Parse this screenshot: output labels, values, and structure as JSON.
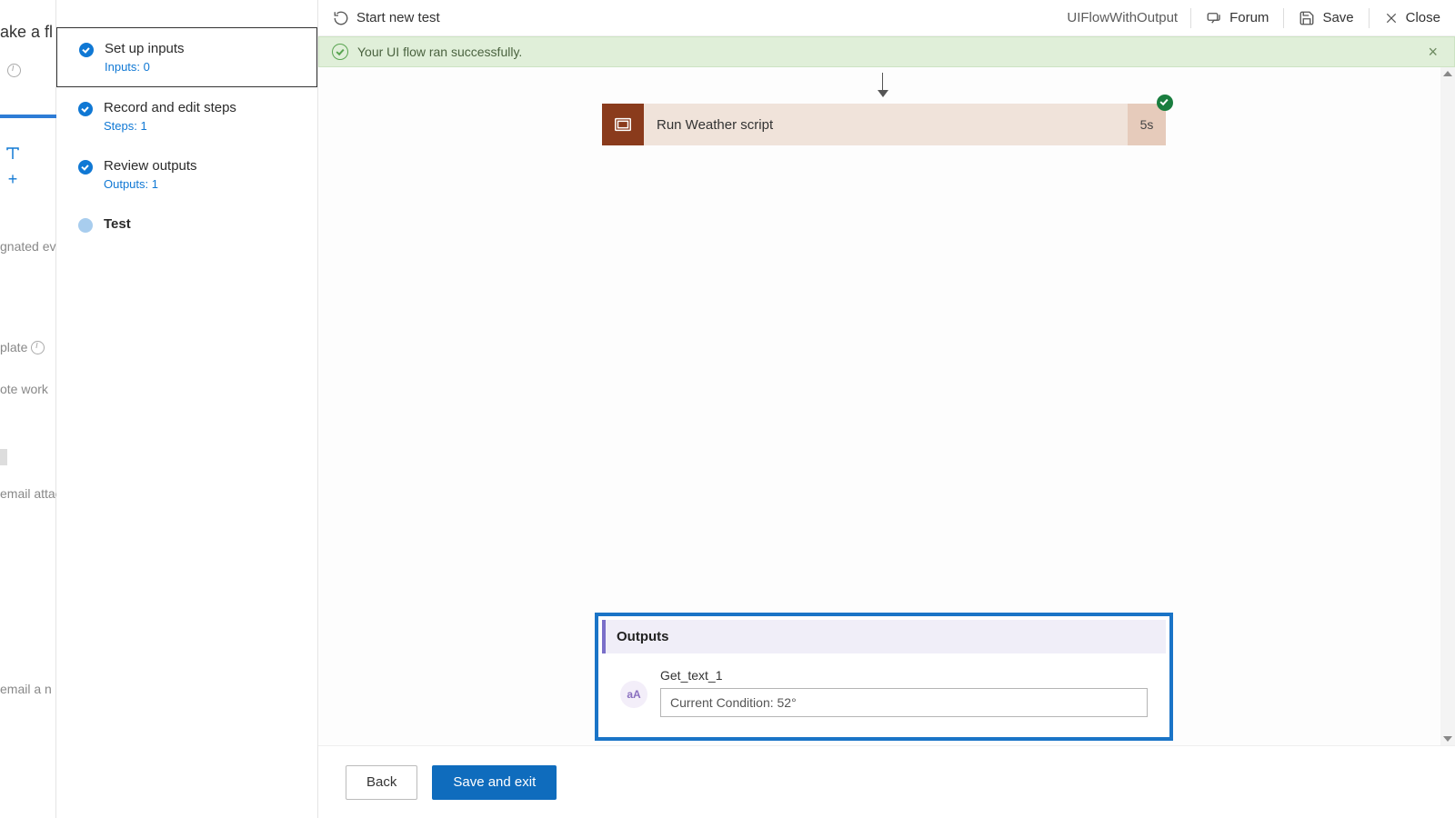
{
  "farleft": {
    "title": "ake a fl",
    "txt1": "gnated even",
    "txt2": "plate",
    "txt3": "ote work",
    "txt4": "email attac",
    "txt5": "email a n"
  },
  "steps": [
    {
      "label": "Set up inputs",
      "sub": "Inputs: 0"
    },
    {
      "label": "Record and edit steps",
      "sub": "Steps: 1"
    },
    {
      "label": "Review outputs",
      "sub": "Outputs: 1"
    },
    {
      "label": "Test",
      "sub": ""
    }
  ],
  "topbar": {
    "new_test": "Start new test",
    "flow_name": "UIFlowWithOutput",
    "forum": "Forum",
    "save": "Save",
    "close": "Close"
  },
  "banner": {
    "message": "Your UI flow ran successfully."
  },
  "action_card": {
    "title": "Run Weather script",
    "time": "5s"
  },
  "outputs_panel": {
    "heading": "Outputs",
    "icon_text": "aA",
    "items": [
      {
        "label": "Get_text_1",
        "value": "Current Condition: 52°"
      }
    ]
  },
  "footer": {
    "back": "Back",
    "save_exit": "Save and exit"
  }
}
